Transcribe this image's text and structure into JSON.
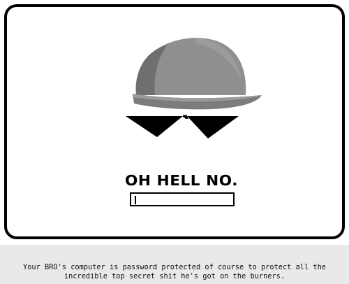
{
  "headline": "OH HELL NO.",
  "password": {
    "value": "",
    "placeholder": ""
  },
  "footer": {
    "line1": "Your BRO's computer is password protected of course to protect all the",
    "line2": "incredible top secret shit he's got on the burners."
  },
  "icons": {
    "hat": "cap-icon",
    "shades": "sunglasses-icon"
  },
  "colors": {
    "cap_light": "#8f8f8f",
    "cap_dark": "#6f6f6f",
    "background": "#ffffff",
    "footer_bg": "#e9e9e9"
  }
}
